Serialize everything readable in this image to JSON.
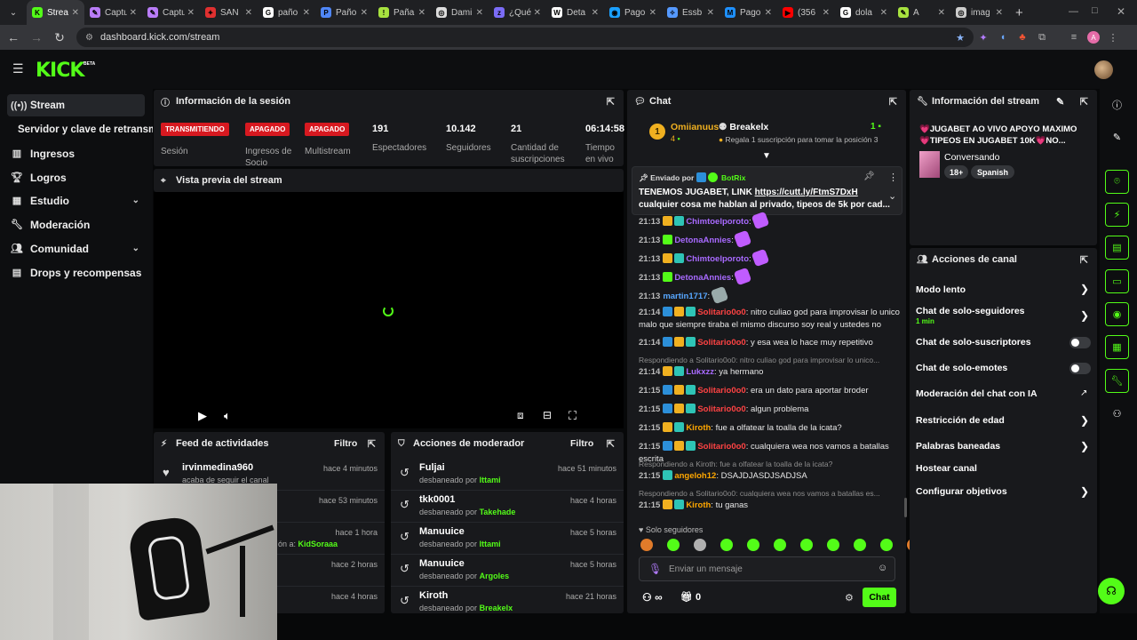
{
  "browser": {
    "tabs": [
      {
        "label": "Strea",
        "color": "#53fc18",
        "letter": "K"
      },
      {
        "label": "Captu",
        "color": "#b97cf8",
        "letter": "✎"
      },
      {
        "label": "Captu",
        "color": "#b97cf8",
        "letter": "✎"
      },
      {
        "label": "SAN",
        "color": "#e03030",
        "letter": "✦"
      },
      {
        "label": "paño",
        "color": "#ffffff",
        "letter": "G"
      },
      {
        "label": "Paño",
        "color": "#4f86f7",
        "letter": "P"
      },
      {
        "label": "Paña",
        "color": "#a7e23f",
        "letter": "!"
      },
      {
        "label": "Dami",
        "color": "#dddddd",
        "letter": "◎"
      },
      {
        "label": "¿Qué",
        "color": "#7b6cf6",
        "letter": "z"
      },
      {
        "label": "Deta",
        "color": "#ffffff",
        "letter": "W"
      },
      {
        "label": "Pago",
        "color": "#1aa0ff",
        "letter": "◉"
      },
      {
        "label": "Essb",
        "color": "#5599ff",
        "letter": "✧"
      },
      {
        "label": "Pago",
        "color": "#1e90ff",
        "letter": "M"
      },
      {
        "label": "(356",
        "color": "#ff0000",
        "letter": "▶"
      },
      {
        "label": "dola",
        "color": "#ffffff",
        "letter": "G"
      },
      {
        "label": "A",
        "color": "#a7e23f",
        "letter": "✎"
      },
      {
        "label": "imag",
        "color": "#cccccc",
        "letter": "◎"
      }
    ],
    "url": "dashboard.kick.com/stream"
  },
  "app": {
    "logo": "KICK",
    "beta": "BETA",
    "accent": "#53fc18"
  },
  "sidebar": {
    "items": [
      {
        "label": "Stream",
        "icon": "broadcast-icon"
      },
      {
        "label": "Servidor y clave de retransmisión",
        "icon": ""
      },
      {
        "label": "Ingresos",
        "icon": "chart-icon"
      },
      {
        "label": "Logros",
        "icon": "trophy-icon"
      },
      {
        "label": "Estudio",
        "icon": "layout-icon"
      },
      {
        "label": "Moderación",
        "icon": "wrench-icon"
      },
      {
        "label": "Comunidad",
        "icon": "people-icon"
      },
      {
        "label": "Drops y recompensas",
        "icon": "gift-icon"
      }
    ]
  },
  "session": {
    "title": "Información de la sesión",
    "badges": [
      {
        "status": "TRANSMITIENDO",
        "label": "Sesión"
      },
      {
        "status": "APAGADO",
        "label": "Ingresos de Socio"
      },
      {
        "status": "APAGADO",
        "label": "Multistream"
      }
    ],
    "stats": [
      {
        "value": "191",
        "label": "Espectadores"
      },
      {
        "value": "10.142",
        "label": "Seguidores"
      },
      {
        "value": "21",
        "label": "Cantidad de suscripciones"
      },
      {
        "value": "06:14:58",
        "label": "Tiempo en vivo"
      }
    ]
  },
  "preview": {
    "title": "Vista previa del stream"
  },
  "activity": {
    "title": "Feed de actividades",
    "filter": "Filtro",
    "rows": [
      {
        "name": "irvinmedina960",
        "sub": "acaba de seguir el canal",
        "time": "hace 4 minutos"
      },
      {
        "name": "",
        "sub": "",
        "time": "hace 53 minutos"
      },
      {
        "name": "",
        "sub": "ón a: ",
        "sub_user": "KidSoraaa",
        "time": "hace 1 hora"
      },
      {
        "name": "",
        "sub": "",
        "time": "hace 2 horas"
      },
      {
        "name": "",
        "sub": "",
        "time": "hace 4 horas"
      }
    ]
  },
  "modactions": {
    "title": "Acciones de moderador",
    "filter": "Filtro",
    "rows": [
      {
        "name": "Fuljai",
        "by_label": "desbaneado por",
        "by": "Ittami",
        "time": "hace 51 minutos"
      },
      {
        "name": "tkk0001",
        "by_label": "desbaneado por",
        "by": "Takehade",
        "time": "hace 4 horas"
      },
      {
        "name": "Manuuice",
        "by_label": "desbaneado por",
        "by": "Ittami",
        "time": "hace 5 horas"
      },
      {
        "name": "Manuuice",
        "by_label": "desbaneado por",
        "by": "Argoles",
        "time": "hace 5 horas"
      },
      {
        "name": "Kiroth",
        "by_label": "desbaneado por",
        "by": "Breakelx",
        "time": "hace 21 horas"
      }
    ]
  },
  "chat": {
    "title": "Chat",
    "leader": {
      "name": "Omiianuus",
      "count": "4",
      "rank": "1"
    },
    "subgoal": {
      "name": "Breakelx",
      "count": "1",
      "text": "Regala 1 suscripción para tomar la posición 3"
    },
    "pinned": {
      "by_label": "Enviado por",
      "by": "BotRix",
      "line1": "TENEMOS JUGABET, LINK ",
      "link": "https://cutt.ly/FtmS7DxH",
      "line2": "cualquier cosa me hablan al privado, tipeos de 5k por cad..."
    },
    "messages": [
      {
        "time": "21:13",
        "user": "Chimtoelporoto",
        "cls": "u-purple",
        "text": ""
      },
      {
        "time": "21:13",
        "user": "DetonaAnnies",
        "cls": "u-purple",
        "text": ""
      },
      {
        "time": "21:13",
        "user": "Chimtoelporoto",
        "cls": "u-purple",
        "text": ""
      },
      {
        "time": "21:13",
        "user": "DetonaAnnies",
        "cls": "u-purple",
        "text": ""
      },
      {
        "time": "21:13",
        "user": "martin1717",
        "cls": "u-blue",
        "text": ""
      },
      {
        "time": "21:14",
        "user": "Solitario0o0",
        "cls": "u-red",
        "text": "nitro culiao god para improvisar lo unico malo que siempre tiraba el mismo discurso soy real y ustedes no"
      },
      {
        "time": "21:14",
        "user": "Solitario0o0",
        "cls": "u-red",
        "text": "y esa wea lo hace muy repetitivo"
      },
      {
        "time": "21:14",
        "user": "Lukxzz",
        "cls": "u-purple",
        "text": "ya hermano",
        "reply": "Respondiendo a Solitario0o0: nitro culiao god para improvisar lo unico..."
      },
      {
        "time": "21:15",
        "user": "Solitario0o0",
        "cls": "u-red",
        "text": "era un dato para aportar broder"
      },
      {
        "time": "21:15",
        "user": "Solitario0o0",
        "cls": "u-red",
        "text": "algun problema"
      },
      {
        "time": "21:15",
        "user": "Kiroth",
        "cls": "u-orange",
        "text": "fue a olfatear la toalla de la icata?"
      },
      {
        "time": "21:15",
        "user": "Solitario0o0",
        "cls": "u-red",
        "text": "cualquiera wea nos vamos a batallas escrita"
      },
      {
        "time": "21:15",
        "user": "angeloh12",
        "cls": "u-orange",
        "text": "DSAJDJASDJSADJSA",
        "reply": "Respondiendo a Kiroth: fue a olfatear la toalla de la icata?"
      },
      {
        "time": "21:15",
        "user": "Kiroth",
        "cls": "u-orange",
        "text": "tu ganas",
        "reply": "Respondiendo a Solitario0o0: cualquiera wea nos vamos a batallas es..."
      }
    ],
    "followers_only": "Solo seguidores",
    "input_placeholder": "Enviar un mensaje",
    "points": "∞",
    "gifts": "0",
    "send": "Chat"
  },
  "streaminfo": {
    "title": "Información del stream",
    "stream_title": "💗JUGABET AO VIVO APOYO MAXIMO 💗TIPEOS EN JUGABET 10K💗NO...",
    "category": "Conversando",
    "tags": [
      "18+",
      "Spanish"
    ]
  },
  "channelactions": {
    "title": "Acciones de canal",
    "items": [
      {
        "label": "Modo lento",
        "kind": "chev"
      },
      {
        "label": "Chat de solo-seguidores",
        "sub": "1 min",
        "kind": "chev"
      },
      {
        "label": "Chat de solo-suscriptores",
        "kind": "toggle"
      },
      {
        "label": "Chat de solo-emotes",
        "kind": "toggle"
      },
      {
        "label": "Moderación del chat con IA",
        "kind": "ext"
      },
      {
        "label": "Restricción de edad",
        "kind": "chev"
      },
      {
        "label": "Palabras baneadas",
        "kind": "chev"
      },
      {
        "label": "Hostear canal",
        "kind": "none"
      },
      {
        "label": "Configurar objetivos",
        "kind": "chev"
      }
    ]
  }
}
